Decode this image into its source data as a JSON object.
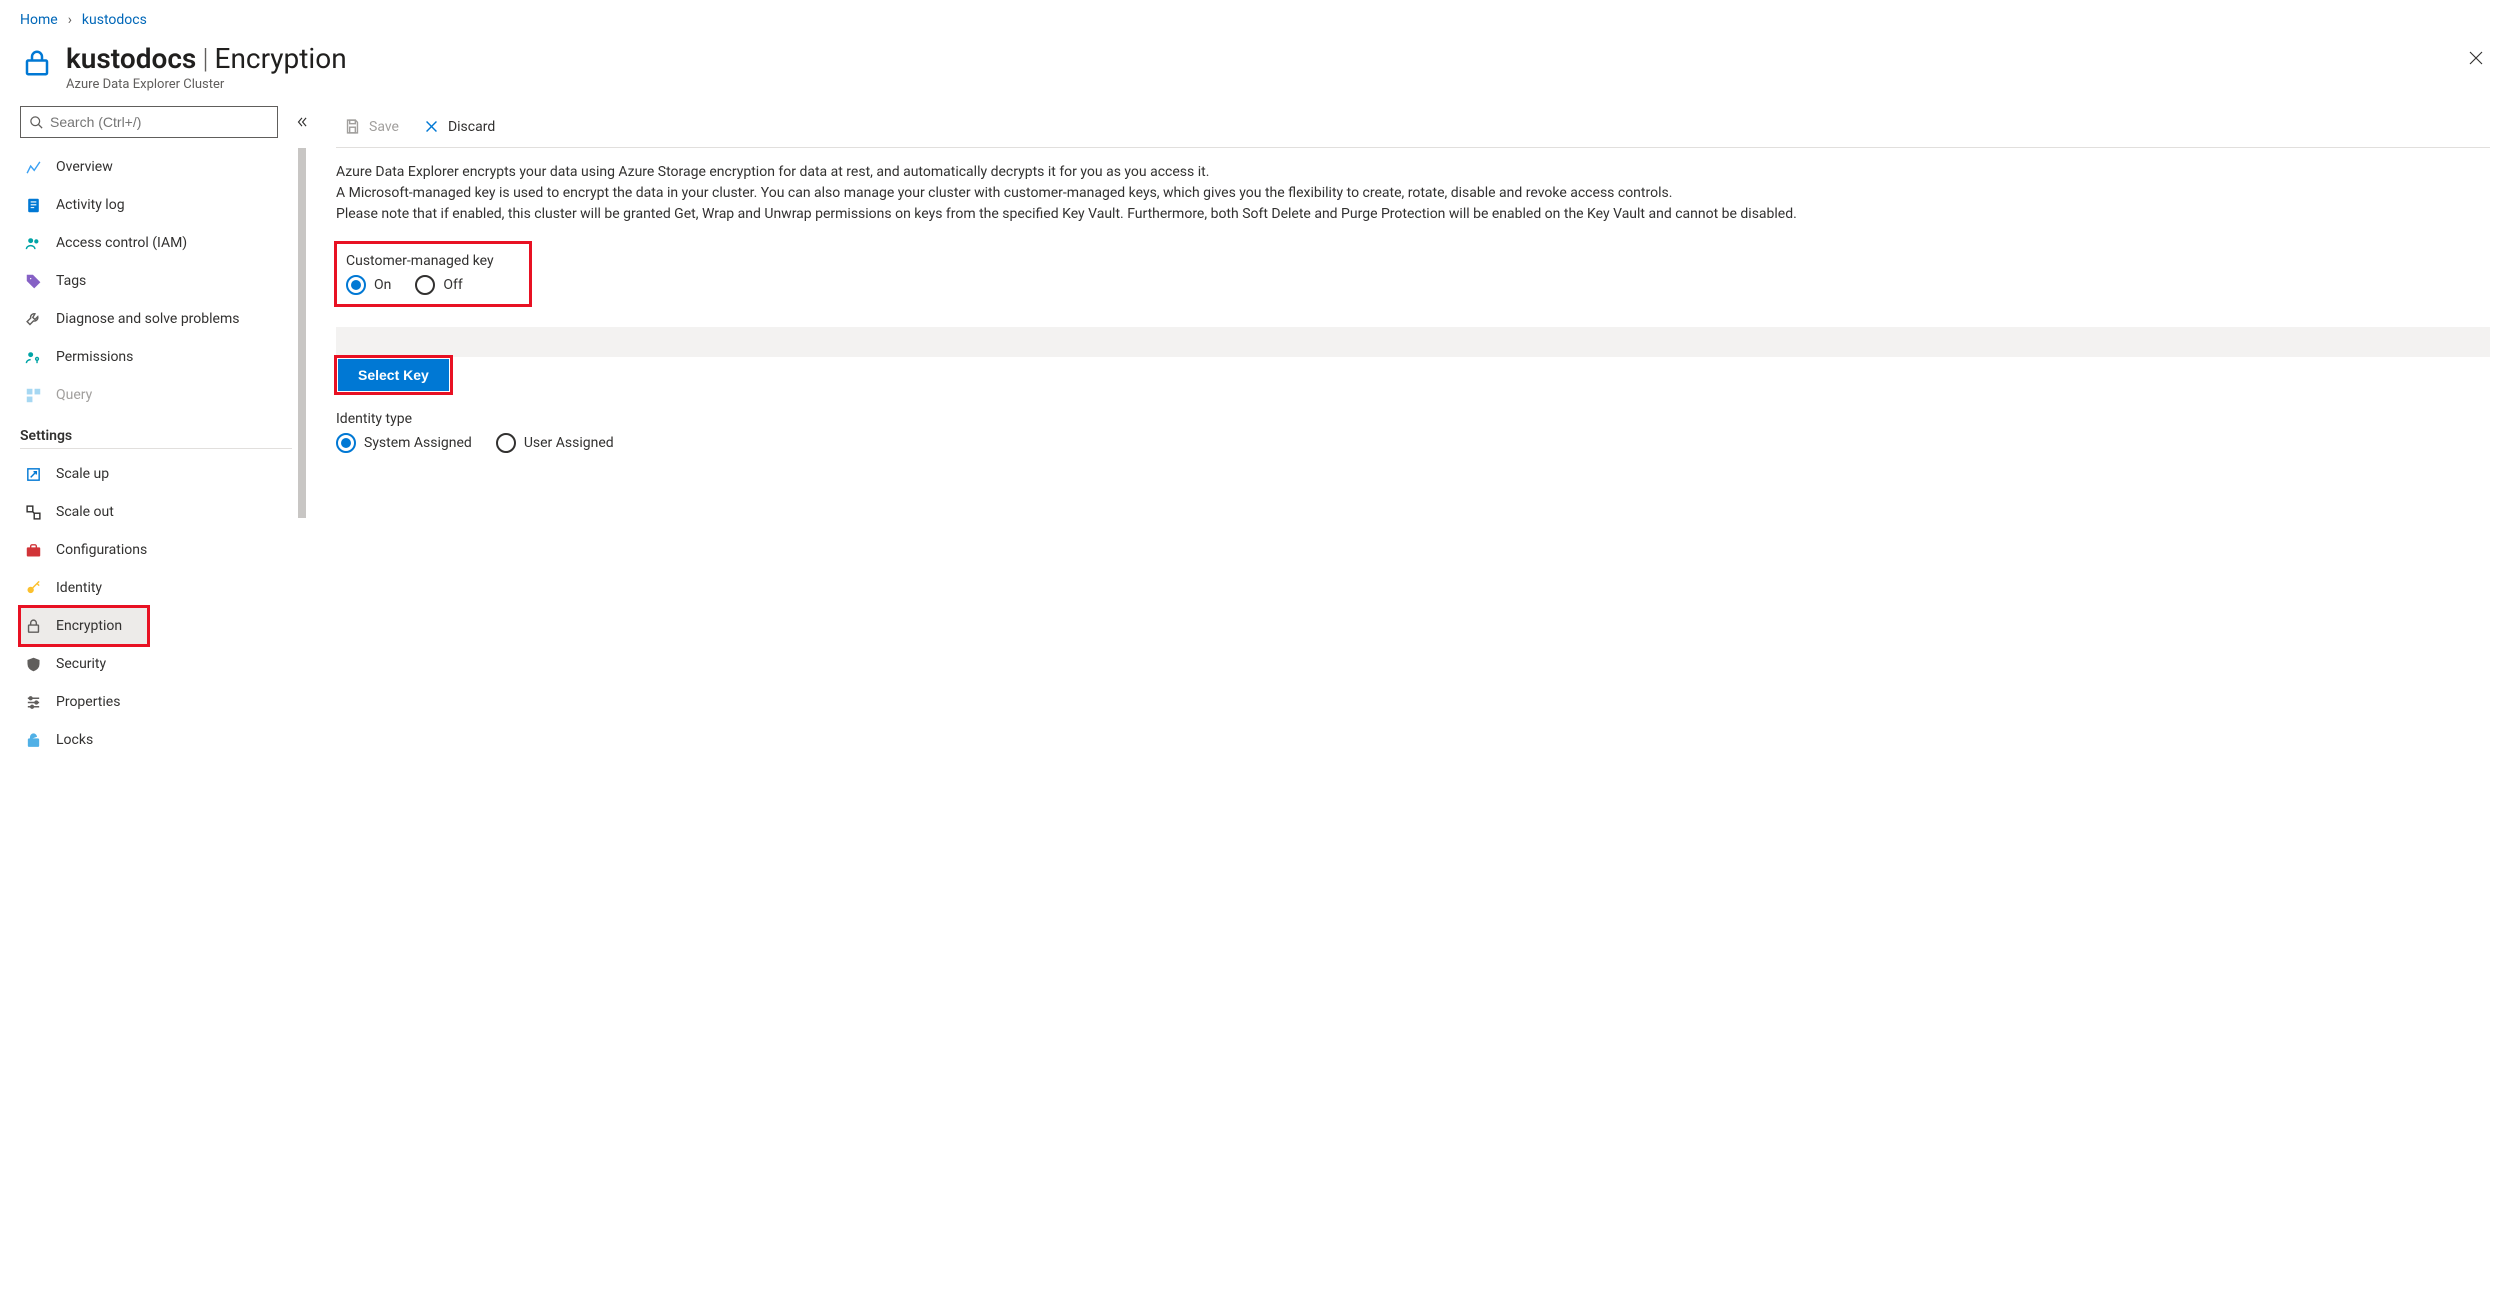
{
  "breadcrumb": {
    "home": "Home",
    "resource": "kustodocs"
  },
  "header": {
    "title": "kustodocs",
    "section": "Encryption",
    "subtitle": "Azure Data Explorer Cluster"
  },
  "search": {
    "placeholder": "Search (Ctrl+/)"
  },
  "sidebar": {
    "items": [
      {
        "label": "Overview"
      },
      {
        "label": "Activity log"
      },
      {
        "label": "Access control (IAM)"
      },
      {
        "label": "Tags"
      },
      {
        "label": "Diagnose and solve problems"
      },
      {
        "label": "Permissions"
      },
      {
        "label": "Query"
      }
    ],
    "settings_heading": "Settings",
    "settings": [
      {
        "label": "Scale up"
      },
      {
        "label": "Scale out"
      },
      {
        "label": "Configurations"
      },
      {
        "label": "Identity"
      },
      {
        "label": "Encryption"
      },
      {
        "label": "Security"
      },
      {
        "label": "Properties"
      },
      {
        "label": "Locks"
      }
    ]
  },
  "cmdbar": {
    "save": "Save",
    "discard": "Discard"
  },
  "description": {
    "l1": "Azure Data Explorer encrypts your data using Azure Storage encryption for data at rest, and automatically decrypts it for you as you access it.",
    "l2": "A Microsoft-managed key is used to encrypt the data in your cluster. You can also manage your cluster with customer-managed keys, which gives you the flexibility to create, rotate, disable and revoke access controls.",
    "l3": "Please note that if enabled, this cluster will be granted Get, Wrap and Unwrap permissions on keys from the specified Key Vault. Furthermore, both Soft Delete and Purge Protection will be enabled on the Key Vault and cannot be disabled."
  },
  "cmk": {
    "label": "Customer-managed key",
    "on": "On",
    "off": "Off"
  },
  "select_key": "Select Key",
  "identity": {
    "label": "Identity type",
    "system": "System Assigned",
    "user": "User Assigned"
  }
}
